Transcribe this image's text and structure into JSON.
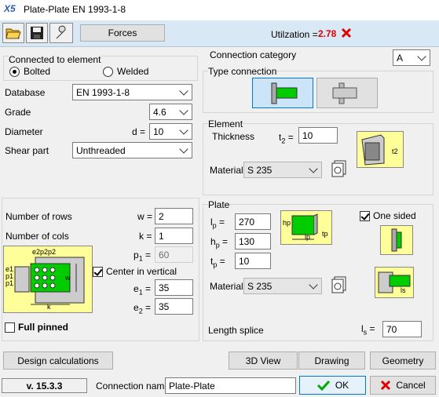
{
  "window": {
    "title": "Plate-Plate EN 1993-1-8",
    "logo": "X5"
  },
  "toolbar": {
    "open_icon": "folder-open-icon",
    "save_icon": "floppy-disk-icon",
    "tools_icon": "wrench-icon",
    "forces_label": "Forces",
    "utilization_label": "Utilzation =",
    "utilization_value": "2.78"
  },
  "connected": {
    "title": "Connected to element",
    "bolted": "Bolted",
    "welded": "Welded",
    "selected": "Bolted"
  },
  "bolts": {
    "database_label": "Database",
    "database_value": "EN 1993-1-8",
    "grade_label": "Grade",
    "grade_value": "4.6",
    "diameter_label": "Diameter",
    "d_label": "d =",
    "diameter_value": "10",
    "shear_label": "Shear part",
    "shear_value": "Unthreaded"
  },
  "layout": {
    "rows_label": "Number of rows",
    "w_label": "w =",
    "rows_value": "2",
    "cols_label": "Number of cols",
    "k_label": "k =",
    "cols_value": "1",
    "p1_label": "p",
    "p1_sub": "1",
    "p1_eq": "=",
    "p1_value": "60",
    "center_label": "Center in vertical",
    "center_checked": true,
    "e1_label": "e",
    "e1_sub": "1",
    "e1_eq": "=",
    "e1_value": "35",
    "e2_label": "e",
    "e2_sub": "2",
    "e2_eq": "=",
    "e2_value": "35",
    "full_pinned": "Full pinned",
    "diagram": {
      "e2p2p2": "e2p2p2",
      "e1": "e1",
      "p1a": "p1",
      "p1b": "p1",
      "w": "w",
      "k": "k"
    }
  },
  "category": {
    "label": "Connection category",
    "value": "A"
  },
  "type_connection": {
    "label": "Type connection"
  },
  "element": {
    "group": "Element",
    "thickness_label": "Thickness",
    "t2_label": "t",
    "t2_sub": "2",
    "t2_eq": "=",
    "t2_value": "10",
    "material_label": "Material",
    "material_value": "S 235",
    "diagram_label": "t2"
  },
  "plate": {
    "group": "Plate",
    "lp_label": "l",
    "lp_sub": "p",
    "lp_eq": "=",
    "lp_value": "270",
    "hp_label": "h",
    "hp_sub": "p",
    "hp_eq": "=",
    "hp_value": "130",
    "tp_label": "t",
    "tp_sub": "p",
    "tp_eq": "=",
    "tp_value": "10",
    "one_sided": "One sided",
    "one_sided_checked": true,
    "material_label": "Material",
    "material_value": "S 235",
    "length_splice_label": "Length splice",
    "ls_label": "l",
    "ls_sub": "s",
    "ls_eq": "=",
    "ls_value": "70",
    "diag_hp": "hp",
    "diag_lp": "lp",
    "diag_tp": "tp",
    "diag_ls": "ls"
  },
  "buttons": {
    "design_calc": "Design calculations",
    "view3d": "3D View",
    "drawing": "Drawing",
    "geometry": "Geometry",
    "ok": "OK",
    "cancel": "Cancel"
  },
  "footer": {
    "version": "v. 15.3.3",
    "connection_name_label": "Connection name",
    "connection_name_value": "Plate-Plate"
  },
  "colors": {
    "accent_red": "#e00000",
    "green": "#00cc00",
    "yellow": "#ffff99",
    "toolbar_bg": "#d9e8f5"
  }
}
